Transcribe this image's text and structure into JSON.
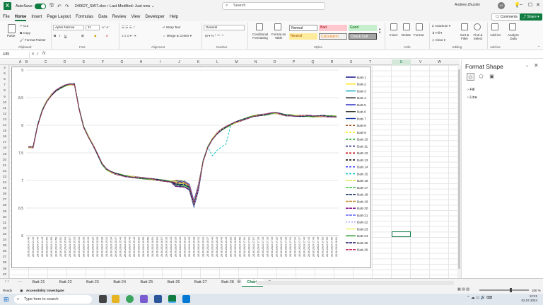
{
  "titlebar": {
    "autosave_label": "AutoSave",
    "autosave_state": "On",
    "filename": "240627_SW7.xlsx • Last Modified: Just now ⌄",
    "search_placeholder": "Search",
    "user": "Andrew Zhuckin",
    "initials": "AZ"
  },
  "menu": [
    "File",
    "Home",
    "Insert",
    "Page Layout",
    "Formulas",
    "Data",
    "Review",
    "View",
    "Developer",
    "Help"
  ],
  "menu_active": "Home",
  "buttons": {
    "comments": "Comments",
    "share": "Share"
  },
  "ribbon": {
    "paste": "Paste",
    "cut": "Cut",
    "copy": "Copy",
    "format_painter": "Format Painter",
    "clipboard": "Clipboard",
    "font_name": "Aptos Narrow",
    "font_size": "11",
    "font": "Font",
    "wrap_text": "Wrap Text",
    "merge_center": "Merge & Center",
    "alignment": "Alignment",
    "number_format": "General",
    "number": "Number",
    "cond_format": "Conditional Formatting",
    "format_table": "Format as Table",
    "style_normal": "Normal",
    "style_bad": "Bad",
    "style_good": "Good",
    "style_neutral": "Neutral",
    "style_calc": "Calculation",
    "style_check": "Check Cell",
    "styles": "Styles",
    "insert": "Insert",
    "delete": "Delete",
    "format": "Format",
    "cells": "Cells",
    "autosum": "AutoSum",
    "fill": "Fill",
    "clear": "Clear",
    "sort_filter": "Sort & Filter",
    "find_select": "Find & Select",
    "editing": "Editing",
    "addins": "Add-ins",
    "analyze_data": "Analyze Data"
  },
  "namebox": "U35",
  "columns": [
    "A",
    "B",
    "C",
    "D",
    "E",
    "F",
    "G",
    "H",
    "I",
    "J",
    "K",
    "L",
    "M",
    "N",
    "O",
    "P",
    "Q",
    "R",
    "S",
    "T",
    "U",
    "V",
    "W"
  ],
  "selected_column": "U",
  "rows": [
    4,
    5,
    6,
    7,
    8,
    9,
    10,
    11,
    12,
    13,
    14,
    15,
    16,
    17,
    18,
    19,
    20,
    21,
    22,
    23,
    24,
    25,
    26,
    27,
    28,
    29,
    30,
    31,
    32,
    33,
    34,
    35,
    36,
    37,
    38,
    39,
    40
  ],
  "format_pane": {
    "title": "Format Shape",
    "sections": [
      "Fill",
      "Line"
    ]
  },
  "sheet_tabs": [
    "Batt-21",
    "Batt-22",
    "Batt-23",
    "Batt-24",
    "Batt-25",
    "Batt-26",
    "Batt-27",
    "Batt-28",
    "Chart",
    "Summary"
  ],
  "active_sheet": "Chart",
  "status": {
    "ready": "Ready",
    "accessibility": "Accessibility: Investigate",
    "zoom": "100 %"
  },
  "taskbar": {
    "search": "Type here to search",
    "time": "12:21",
    "date": "02.07.2024"
  },
  "chart_data": {
    "type": "line",
    "ylim": [
      6,
      9
    ],
    "yticks": [
      "9",
      "8,5",
      "8",
      "7,5",
      "7",
      "6,5",
      "6"
    ],
    "x": [
      "28.06.2024 14:40",
      "28.06.2024 14:43",
      "28.06.2024 14:46",
      "28.06.2024 14:49",
      "28.06.2024 14:52",
      "28.06.2024 14:55",
      "28.06.2024 14:58",
      "28.06.2024 15:01",
      "28.06.2024 15:04",
      "28.06.2024 15:07",
      "28.06.2024 15:10",
      "28.06.2024 15:13",
      "28.06.2024 15:16",
      "28.06.2024 15:19",
      "28.06.2024 15:22",
      "28.06.2024 15:25",
      "28.06.2024 15:28",
      "28.06.2024 15:31",
      "28.06.2024 15:34",
      "28.06.2024 15:37",
      "28.06.2024 15:40",
      "28.06.2024 15:43",
      "28.06.2024 15:46",
      "28.06.2024 15:49",
      "28.06.2024 15:52",
      "28.06.2024 15:55",
      "28.06.2024 15:58",
      "28.06.2024 16:01",
      "28.06.2024 16:04",
      "28.06.2024 16:07",
      "28.06.2024 16:10",
      "28.06.2024 16:13",
      "28.06.2024 16:16",
      "28.06.2024 16:19",
      "28.06.2024 16:22",
      "28.06.2024 16:25",
      "28.06.2024 16:28",
      "28.06.2024 16:31",
      "28.06.2024 16:34",
      "28.06.2024 16:37",
      "28.06.2024 16:40",
      "28.06.2024 16:43",
      "28.06.2024 16:46",
      "28.06.2024 16:49",
      "28.06.2024 16:52",
      "28.06.2024 16:55",
      "28.06.2024 16:58",
      "28.06.2024 17:01",
      "28.06.2024 17:04",
      "28.06.2024 17:07",
      "28.06.2024 17:10",
      "28.06.2024 17:13",
      "28.06.2024 17:16",
      "28.06.2024 17:19",
      "28.06.2024 17:22",
      "28.06.2024 17:25",
      "28.06.2024 17:28",
      "28.06.2024 17:31",
      "28.06.2024 17:34",
      "28.06.2024 17:37",
      "28.06.2024 17:40",
      "28.06.2024 17:43",
      "28.06.2024 17:46",
      "28.06.2024 17:49",
      "28.06.2024 17:52",
      "28.06.2024 17:55",
      "28.06.2024 17:58",
      "28.06.2024 18:01"
    ],
    "base": [
      7.6,
      7.6,
      8.0,
      8.27,
      8.44,
      8.55,
      8.63,
      8.68,
      8.72,
      8.74,
      8.74,
      8.3,
      7.97,
      7.8,
      7.65,
      7.48,
      7.3,
      7.2,
      7.15,
      7.12,
      7.1,
      7.08,
      7.07,
      7.06,
      7.05,
      7.04,
      7.03,
      7.02,
      7.01,
      7.0,
      6.99,
      6.98,
      6.97,
      6.96,
      6.95,
      6.9,
      6.6,
      6.9,
      7.35,
      7.6,
      7.75,
      7.85,
      7.92,
      7.97,
      8.01,
      8.05,
      8.08,
      8.11,
      8.14,
      8.17,
      8.18,
      8.19,
      8.2,
      8.22,
      8.22,
      8.2,
      8.18,
      8.18,
      8.17,
      8.17,
      8.17,
      8.17,
      8.16,
      8.16,
      8.17,
      8.16,
      8.16,
      8.16
    ],
    "series": [
      {
        "name": "Batt-1",
        "color": "#000080",
        "dash": ""
      },
      {
        "name": "Batt-2",
        "color": "#ffe000",
        "dash": ""
      },
      {
        "name": "Batt-3",
        "color": "#00a0c0",
        "dash": ""
      },
      {
        "name": "Batt-4",
        "color": "#101010",
        "dash": ""
      },
      {
        "name": "Batt-5",
        "color": "#2020c0",
        "dash": ""
      },
      {
        "name": "Batt-6",
        "color": "#303030",
        "dash": ""
      },
      {
        "name": "Batt-7",
        "color": "#1030a0",
        "dash": ""
      },
      {
        "name": "Batt-8",
        "color": "#a05020",
        "dash": "3,2"
      },
      {
        "name": "Batt-9",
        "color": "#f0f000",
        "dash": "3,2"
      },
      {
        "name": "Batt-10",
        "color": "#00a000",
        "dash": "3,2"
      },
      {
        "name": "Batt-11",
        "color": "#202080",
        "dash": "3,2"
      },
      {
        "name": "Batt-12",
        "color": "#c00000",
        "dash": "3,2"
      },
      {
        "name": "Batt-13",
        "color": "#000000",
        "dash": "3,2"
      },
      {
        "name": "Batt-14",
        "color": "#4040ff",
        "dash": "3,2"
      },
      {
        "name": "Batt-15",
        "color": "#00c0c0",
        "dash": "3,2"
      },
      {
        "name": "Batt-16",
        "color": "#e0e040",
        "dash": "4,1"
      },
      {
        "name": "Batt-17",
        "color": "#40c040",
        "dash": "4,1"
      },
      {
        "name": "Batt-18",
        "color": "#103060",
        "dash": "4,1"
      },
      {
        "name": "Batt-19",
        "color": "#c08020",
        "dash": "4,1"
      },
      {
        "name": "Batt-20",
        "color": "#800080",
        "dash": "4,1"
      },
      {
        "name": "Batt-21",
        "color": "#6060ff",
        "dash": "4,1"
      },
      {
        "name": "Batt-22",
        "color": "#a0a0ff",
        "dash": "2,2"
      },
      {
        "name": "Batt-23",
        "color": "#f0f060",
        "dash": ""
      },
      {
        "name": "Batt-24",
        "color": "#209020",
        "dash": ""
      },
      {
        "name": "Batt-25",
        "color": "#101060",
        "dash": "4,1"
      },
      {
        "name": "Batt-26",
        "color": "#c03060",
        "dash": "4,1"
      }
    ]
  }
}
